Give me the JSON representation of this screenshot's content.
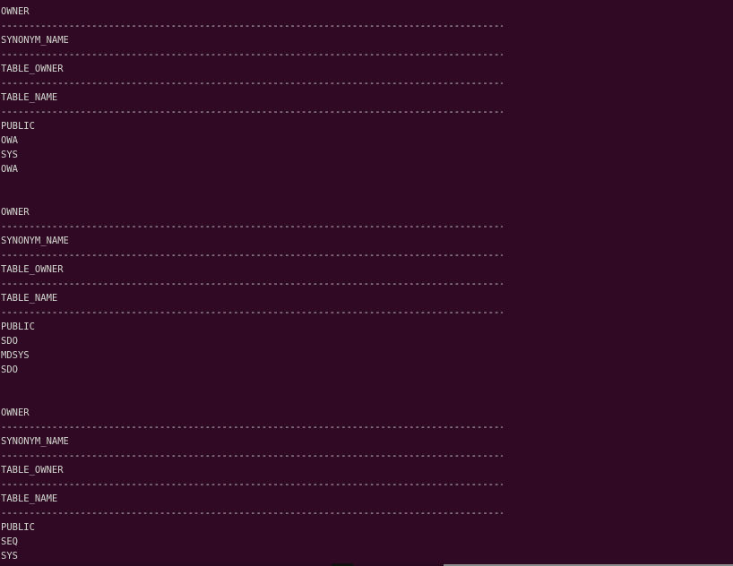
{
  "terminal": {
    "dash_line": "----------------------------------------------------------------------------------------------------------------------------",
    "blocks": [
      {
        "headers": [
          "OWNER",
          "SYNONYM_NAME",
          "TABLE_OWNER",
          "TABLE_NAME"
        ],
        "values": [
          "PUBLIC",
          "OWA",
          "SYS",
          "OWA"
        ]
      },
      {
        "headers": [
          "OWNER",
          "SYNONYM_NAME",
          "TABLE_OWNER",
          "TABLE_NAME"
        ],
        "values": [
          "PUBLIC",
          "SDO",
          "MDSYS",
          "SDO"
        ]
      },
      {
        "headers": [
          "OWNER",
          "SYNONYM_NAME",
          "TABLE_OWNER",
          "TABLE_NAME"
        ],
        "values": [
          "PUBLIC",
          "SEQ",
          "SYS"
        ]
      }
    ]
  },
  "colors": {
    "background": "#300a24",
    "text": "#d3d7cf"
  }
}
